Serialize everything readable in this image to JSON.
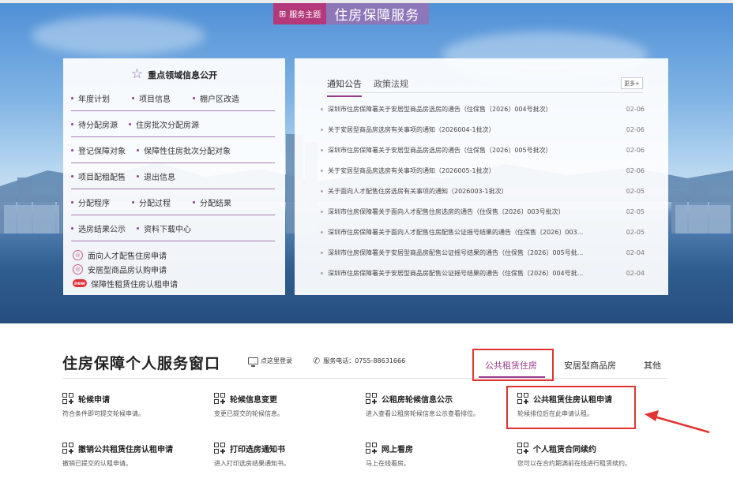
{
  "theme": {
    "badge_label": "服务主题",
    "title": "住房保障服务"
  },
  "left_panel": {
    "heading": "重点领域信息公开",
    "rows": [
      [
        "年度计划",
        "项目信息",
        "棚户区改造"
      ],
      [
        "待分配房源",
        "住房批次分配房源"
      ],
      [
        "登记保障对象",
        "保障性住房批次分配对象"
      ],
      [
        "项目配租配售",
        "退出信息"
      ],
      [
        "分配程序",
        "分配过程",
        "分配结果"
      ],
      [
        "选房结果公示",
        "资料下载中心"
      ]
    ],
    "links": [
      {
        "label": "面向人才配售住房申请",
        "icon": "circle-badge-icon"
      },
      {
        "label": "安居型商品房认购申请",
        "icon": "circle-badge-icon"
      },
      {
        "label": "保障性租赁住房认租申请",
        "icon": "new-badge-icon",
        "badge": "new"
      }
    ]
  },
  "right_panel": {
    "tabs": [
      "通知公告",
      "政策法规"
    ],
    "more_label": "更多+",
    "news": [
      {
        "title": "深圳市住房保障署关于安居型商品房选房的通告（住保售〔2026〕004号批次）",
        "date": "02-06"
      },
      {
        "title": "关于安居型商品房选房有关事项的通知（2026004-1批次）",
        "date": "02-06"
      },
      {
        "title": "深圳市住房保障署关于安居型商品房选房的通告（住保售〔2026〕005号批次）",
        "date": "02-06"
      },
      {
        "title": "关于安居型商品房选房有关事项的通知（2026005-1批次）",
        "date": "02-06"
      },
      {
        "title": "关于面向人才配售住房选房有关事项的通知（2026003-1批次）",
        "date": "02-05"
      },
      {
        "title": "深圳市住房保障署关于面向人才配售住房选房的通告（住保售〔2026〕003号批次）",
        "date": "02-05"
      },
      {
        "title": "深圳市住房保障署关于面向人才配售住房配售公证摇号结果的通告（住保售〔2026〕003...",
        "date": "02-05"
      },
      {
        "title": "深圳市住房保障署关于安居型商品房配售公证摇号结果的通告（住保售〔2026〕005号批...",
        "date": "02-04"
      },
      {
        "title": "深圳市住房保障署关于安居型商品房配售公证摇号结果的通告（住保售〔2026〕004号批...",
        "date": "02-04"
      }
    ]
  },
  "service": {
    "title": "住房保障个人服务窗口",
    "login_label": "点这里登录",
    "phone_label": "服务电话：0755-88631666",
    "tabs": [
      "公共租赁住房",
      "安居型商品房",
      "其他"
    ],
    "cards": [
      {
        "title": "轮候申请",
        "desc": "符合条件即可提交轮候申请。"
      },
      {
        "title": "轮候信息变更",
        "desc": "变更已提交的轮候信息。"
      },
      {
        "title": "公租房轮候信息公示",
        "desc": "进入查看公租房轮候信息公示查看排位。"
      },
      {
        "title": "公共租赁住房认租申请",
        "desc": "轮候排位后在此申请认租。"
      },
      {
        "title": "撤销公共租赁住房认租申请",
        "desc": "撤销已提交的认租申请。"
      },
      {
        "title": "打印选房通知书",
        "desc": "进入打印选房结果通知书。"
      },
      {
        "title": "网上看房",
        "desc": "马上在线看房。"
      },
      {
        "title": "个人租赁合同续约",
        "desc": "您可以在合约期满前在线进行租赁续约。"
      }
    ]
  },
  "colors": {
    "accent": "#9c3a8c",
    "highlight": "#e2332f",
    "theme_badge": "#b4397a",
    "theme_title": "#8d77b8"
  }
}
